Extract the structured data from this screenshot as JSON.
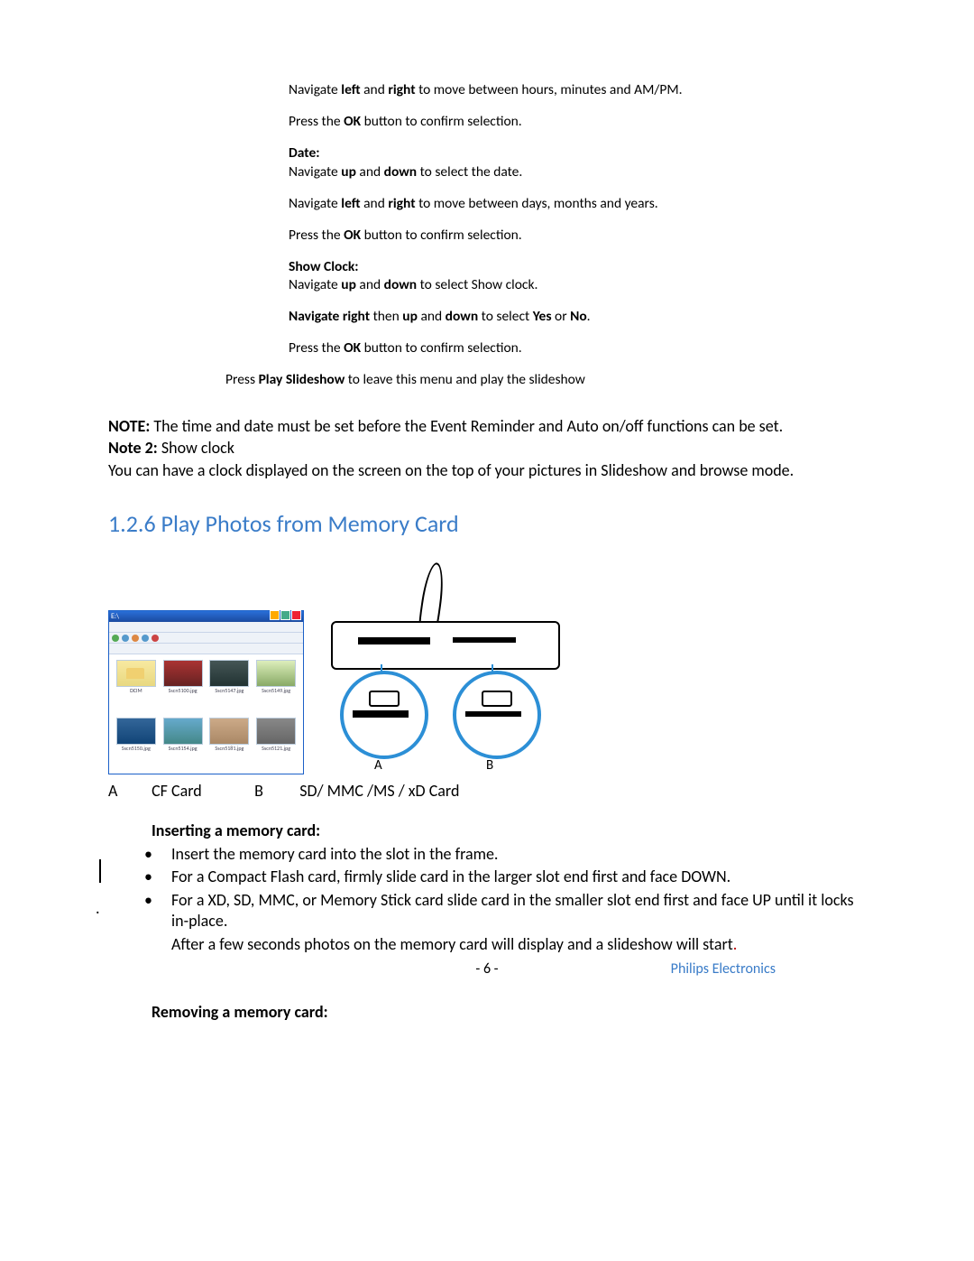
{
  "instructions": {
    "line1_a": "Navigate ",
    "line1_b": "left",
    "line1_c": " and ",
    "line1_d": "right",
    "line1_e": " to move between hours, minutes and AM/PM.",
    "line2_a": "Press the ",
    "line2_b": "OK",
    "line2_c": " button to confirm selection.",
    "date_label": "Date:",
    "line3_a": "Navigate ",
    "line3_b": "up",
    "line3_c": " and ",
    "line3_d": "down",
    "line3_e": " to select the date.",
    "line4_a": "Navigate ",
    "line4_b": "left",
    "line4_c": " and ",
    "line4_d": "right",
    "line4_e": " to move between days, months and years.",
    "line5_a": "Press the ",
    "line5_b": "OK",
    "line5_c": " button to confirm selection.",
    "showclock_label": "Show Clock:",
    "line6_a": "Navigate ",
    "line6_b": "up",
    "line6_c": " and ",
    "line6_d": "down",
    "line6_e": " to select Show clock.",
    "line7_a": "Navigate right",
    "line7_b": " then ",
    "line7_c": "up",
    "line7_d": " and ",
    "line7_e": "down",
    "line7_f": " to select ",
    "line7_g": "Yes",
    "line7_h": " or ",
    "line7_i": "No",
    "line7_j": ".",
    "line8_a": "Press the ",
    "line8_b": "OK",
    "line8_c": " button to confirm selection.",
    "line9_a": "Press ",
    "line9_b": "Play Slideshow",
    "line9_c": " to leave this menu and play the slideshow"
  },
  "note": {
    "n1_a": "NOTE:",
    "n1_b": " The time and date must be set before the Event Reminder and Auto on/off functions can be set.",
    "n2_a": "Note 2:",
    "n2_b": " Show clock",
    "n3": "You can have a clock displayed on the screen on the top of your pictures in Slideshow and browse mode."
  },
  "section_heading": "1.2.6 Play Photos from Memory Card",
  "card_labels": {
    "a": "A",
    "a_text": "CF Card",
    "b": "B",
    "b_text": "SD/ MMC /MS / xD Card"
  },
  "figure": {
    "window_title": "E:\\",
    "thumb_labels": [
      "DCIM",
      "Sscn5100.jpg",
      "Sscn5147.jpg",
      "Sscn5149.jpg",
      "Sscn5150.jpg",
      "Sscn5154.jpg",
      "Sscn5181.jpg",
      "Sscn5121.jpg"
    ]
  },
  "insert": {
    "heading": "Inserting a memory card:",
    "b1": "Insert the memory card into the slot in the frame.",
    "b2": "For a Compact Flash card, firmly slide card in the larger slot end first and face DOWN.",
    "b3": "For a XD, SD, MMC, or Memory Stick card slide card in the smaller slot end first and face UP until it locks in-place.",
    "tail_a": "After a few seconds photos on the memory card will display and a slideshow will start",
    "tail_dot": "."
  },
  "removing_heading": "Removing a memory card:",
  "page_number": "- 6 -",
  "brand": "Philips Electronics"
}
